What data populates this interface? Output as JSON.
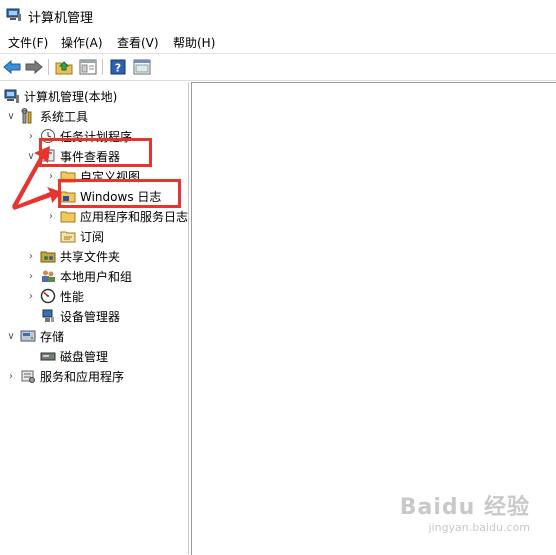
{
  "window": {
    "title": "计算机管理"
  },
  "menu": [
    "文件(F)",
    "操作(A)",
    "查看(V)",
    "帮助(H)"
  ],
  "toolbar": {
    "icons": [
      "back-arrow-icon",
      "forward-arrow-icon",
      "up-folder-icon",
      "properties-icon",
      "help-icon",
      "show-hide-pane-icon"
    ]
  },
  "tree": {
    "root": "计算机管理(本地)",
    "system_tools": "系统工具",
    "task_scheduler": "任务计划程序",
    "event_viewer": "事件查看器",
    "custom_views": "自定义视图",
    "windows_logs": "Windows 日志",
    "app_service_logs": "应用程序和服务日志",
    "subscriptions": "订阅",
    "shared_folders": "共享文件夹",
    "local_users": "本地用户和组",
    "performance": "性能",
    "device_manager": "设备管理器",
    "storage": "存储",
    "disk_management": "磁盘管理",
    "services_apps": "服务和应用程序"
  },
  "colors": {
    "annotation": "#e8342e"
  },
  "watermark": {
    "brand": "Baidu 经验",
    "url": "jingyan.baidu.com"
  }
}
